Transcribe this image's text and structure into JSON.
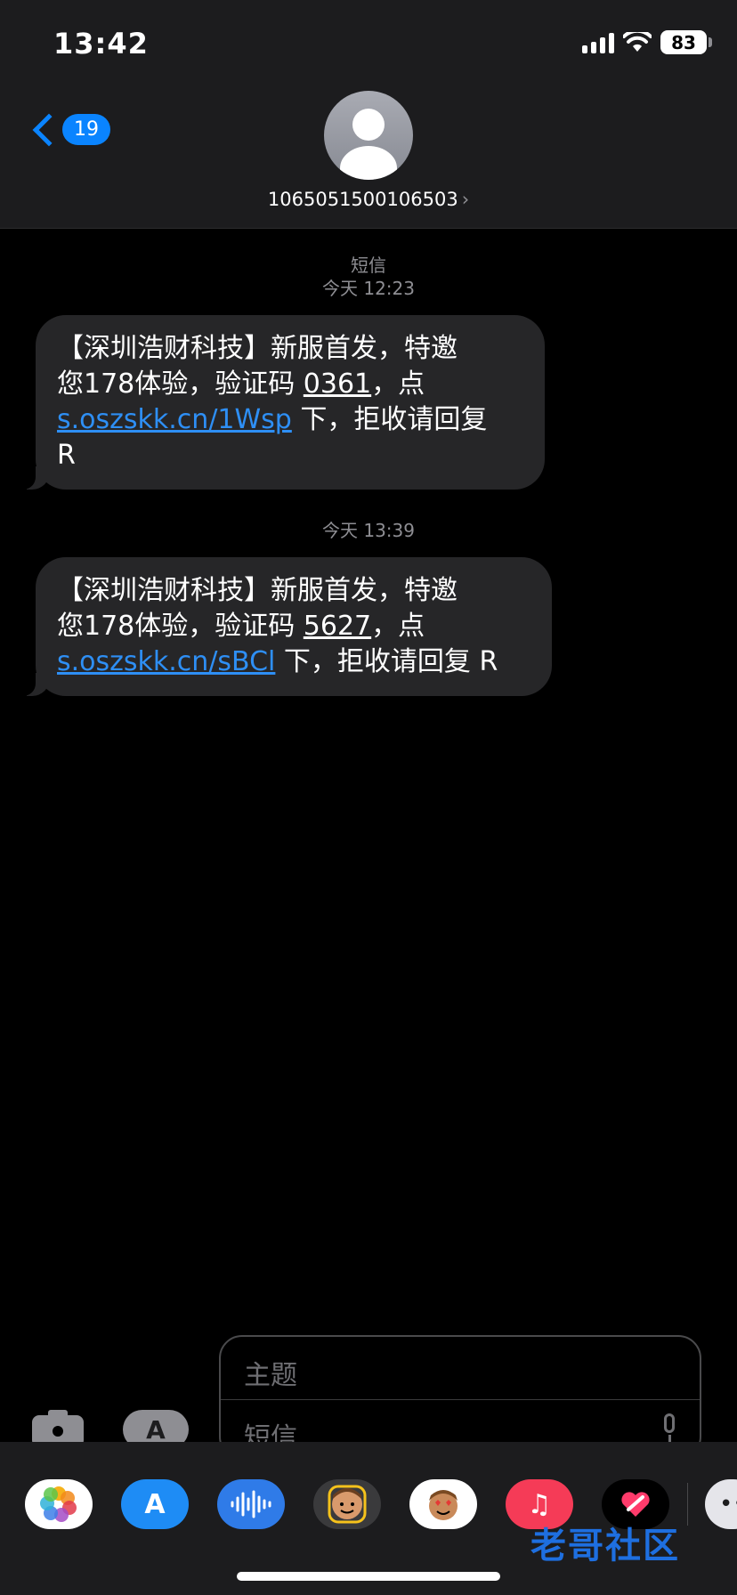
{
  "status_bar": {
    "time": "13:42",
    "battery": "83"
  },
  "header": {
    "back_count": "19",
    "contact": "1065051500106503",
    "contact_chevron": "›"
  },
  "messages": [
    {
      "service": "短信",
      "timestamp": "今天 12:23",
      "line1": "【深圳浩财科技】新服首发，特邀",
      "line2_pre": "您178体验，验证码 ",
      "code": "0361",
      "line2_post": "，点",
      "link": "s.oszskk.cn/1Wsp",
      "line3_post": " 下，拒收请回复",
      "line4": "R"
    },
    {
      "timestamp": "今天 13:39",
      "line1": "【深圳浩财科技】新服首发，特邀",
      "line2_pre": "您178体验，验证码 ",
      "code": "5627",
      "line2_post": "，点",
      "link": "s.oszskk.cn/sBCl",
      "line3_post": " 下，拒收请回复 R"
    }
  ],
  "composer": {
    "subject_placeholder": "主题",
    "body_placeholder": "短信"
  },
  "app_strip": {
    "icons": [
      "photos-icon",
      "app-store-icon",
      "audio-message-icon",
      "memoji-icon",
      "animoji-icon",
      "music-icon",
      "digital-touch-icon",
      "more-icon"
    ]
  },
  "watermark": "老哥社区",
  "colors": {
    "accent": "#0a84ff",
    "link": "#2e8ff5",
    "bubble": "#262628",
    "header_bg": "#1c1c1e"
  }
}
